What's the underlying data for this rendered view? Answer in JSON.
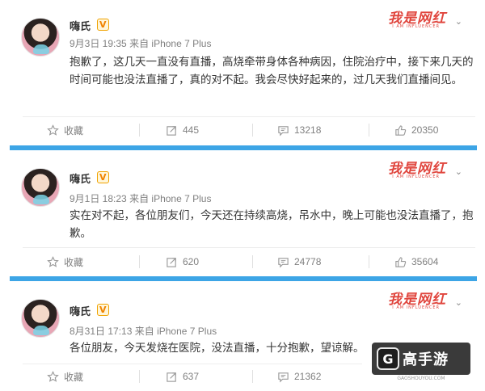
{
  "brand": {
    "name": "我是网红",
    "sub": "I AM INFLUENCER"
  },
  "vip_label": "V",
  "posts": [
    {
      "user": "嗨氏",
      "time": "9月3日 19:35",
      "source": "来自 iPhone 7 Plus",
      "text": "抱歉了，这几天一直没有直播，高烧牵带身体各种病因，住院治疗中，接下来几天的时间可能也没法直播了，真的对不起。我会尽快好起来的，过几天我们直播间见。",
      "favorite": "收藏",
      "repost": "445",
      "comment": "13218",
      "like": "20350"
    },
    {
      "user": "嗨氏",
      "time": "9月1日 18:23",
      "source": "来自 iPhone 7 Plus",
      "text": "实在对不起，各位朋友们，今天还在持续高烧，吊水中，晚上可能也没法直播了，抱歉。",
      "favorite": "收藏",
      "repost": "620",
      "comment": "24778",
      "like": "35604"
    },
    {
      "user": "嗨氏",
      "time": "8月31日 17:13",
      "source": "来自 iPhone 7 Plus",
      "text": "各位朋友，今天发烧在医院，没法直播，十分抱歉，望谅解。",
      "favorite": "收藏",
      "repost": "637",
      "comment": "21362",
      "like": ""
    }
  ],
  "watermark": {
    "title": "高手游",
    "url": "GAOSHOUYOU.COM"
  },
  "colors": {
    "divider": "#3da5e6",
    "brand": "#e0463e"
  }
}
